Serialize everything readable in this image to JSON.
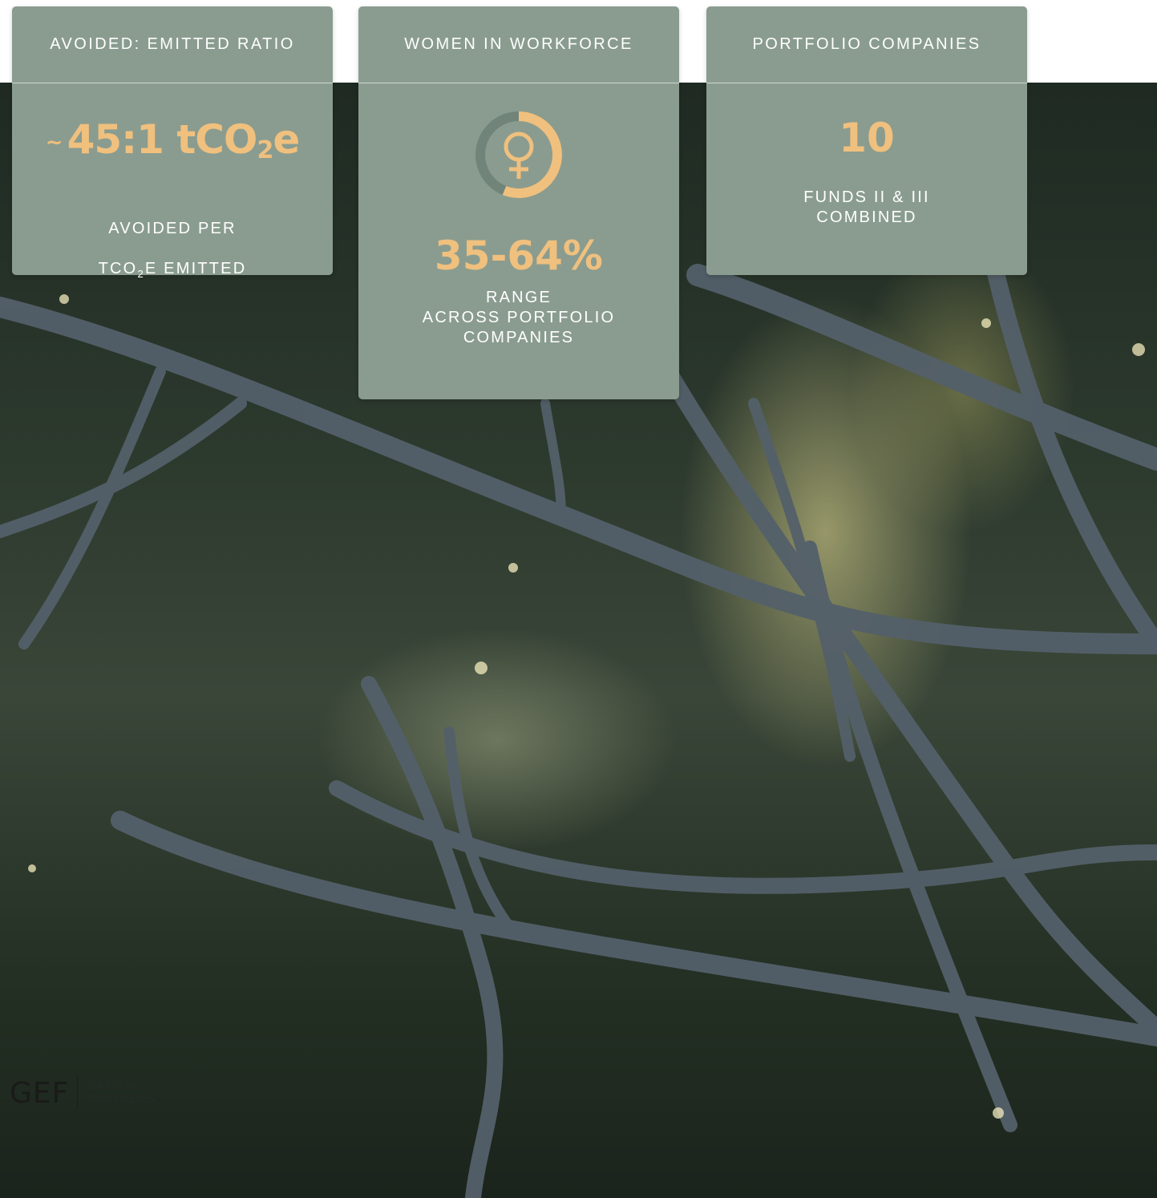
{
  "cards": [
    {
      "header": "AVOIDED: EMITTED RATIO",
      "prefix": "~",
      "value_main": "45:1 tCO",
      "value_sub": "2",
      "value_end": "e",
      "caption_line1": "AVOIDED PER",
      "caption_line2_a": "TCO",
      "caption_line2_sub": "2",
      "caption_line2_b": "E EMITTED"
    },
    {
      "header": "WOMEN IN WORKFORCE",
      "icon": "female-symbol-icon",
      "value": "35-64%",
      "caption": "RANGE\nACROSS PORTFOLIO\nCOMPANIES"
    },
    {
      "header": "PORTFOLIO COMPANIES",
      "value": "10",
      "caption": "FUNDS II & III\nCOMBINED"
    }
  ],
  "logo": {
    "mark": "GEF",
    "line1": "CAPITAL",
    "line2": "PARTNERS"
  },
  "colors": {
    "card": "#8a9c8f",
    "accent": "#f0c07e",
    "text": "#ffffff"
  }
}
